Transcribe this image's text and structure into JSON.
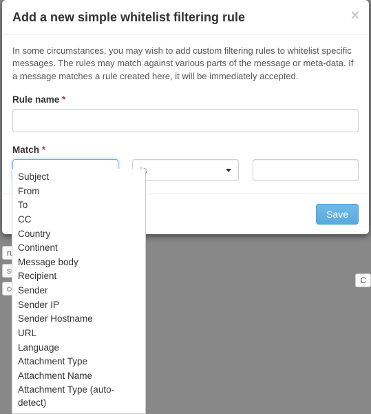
{
  "modal": {
    "title": "Add a new simple whitelist filtering rule",
    "close_label": "×",
    "help": "In some circumstances, you may wish to add custom filtering rules to whitelist specific messages. The rules may match against various parts of the message or meta-data. If a message matches a rule created here, it will be immediately accepted.",
    "rule_name_label": "Rule name",
    "rule_name_value": "",
    "match_label": "Match",
    "required_mark": "*",
    "field_select_value": "",
    "operator_select_value": "is",
    "match_value": "",
    "save_label": "Save"
  },
  "field_options": [
    "Subject",
    "From",
    "To",
    "CC",
    "Country",
    "Continent",
    "Message body",
    "Recipient",
    "Sender",
    "Sender IP",
    "Sender Hostname",
    "URL",
    "Language",
    "Attachment Type",
    "Attachment Name",
    "Attachment Type (auto-detect)"
  ],
  "backdrop": {
    "tab_left_1": "ru",
    "tab_left_2": "sul",
    "tab_left_3": "co",
    "tab_right": "C"
  }
}
